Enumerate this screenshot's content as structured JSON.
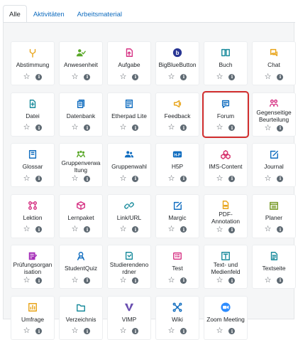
{
  "tabs": [
    {
      "label": "Alle",
      "active": true
    },
    {
      "label": "Aktivitäten",
      "active": false
    },
    {
      "label": "Arbeitsmaterial",
      "active": false
    }
  ],
  "tiles": [
    {
      "name": "Abstimmung",
      "icon": "choice-icon",
      "color": "#e8a419"
    },
    {
      "name": "Anwesenheit",
      "icon": "attendance-icon",
      "color": "#5aa829"
    },
    {
      "name": "Aufgabe",
      "icon": "assignment-icon",
      "color": "#d63384"
    },
    {
      "name": "BigBlueButton",
      "icon": "bigbluebutton-icon",
      "color": "#283593"
    },
    {
      "name": "Buch",
      "icon": "book-icon",
      "color": "#198b9c"
    },
    {
      "name": "Chat",
      "icon": "chat-icon",
      "color": "#e8a419"
    },
    {
      "name": "Datei",
      "icon": "file-icon",
      "color": "#198b9c"
    },
    {
      "name": "Datenbank",
      "icon": "database-icon",
      "color": "#0f6cbf"
    },
    {
      "name": "Etherpad Lite",
      "icon": "etherpad-icon",
      "color": "#0f6cbf"
    },
    {
      "name": "Feedback",
      "icon": "feedback-icon",
      "color": "#e8a419"
    },
    {
      "name": "Forum",
      "icon": "forum-icon",
      "color": "#0f6cbf",
      "selected": true
    },
    {
      "name": "Gegenseitige Beurteilung",
      "icon": "workshop-icon",
      "color": "#d63384"
    },
    {
      "name": "Glossar",
      "icon": "glossary-icon",
      "color": "#0f6cbf"
    },
    {
      "name": "Gruppenverwaltung",
      "icon": "groupmanagement-icon",
      "color": "#5aa829"
    },
    {
      "name": "Gruppenwahl",
      "icon": "groupchoice-icon",
      "color": "#0f6cbf"
    },
    {
      "name": "H5P",
      "icon": "h5p-icon",
      "color": "#0f6cbf"
    },
    {
      "name": "IMS-Content",
      "icon": "ims-content-icon",
      "color": "#d6336c"
    },
    {
      "name": "Journal",
      "icon": "journal-icon",
      "color": "#0f6cbf"
    },
    {
      "name": "Lektion",
      "icon": "lesson-icon",
      "color": "#d63384"
    },
    {
      "name": "Lernpaket",
      "icon": "scorm-icon",
      "color": "#d63384"
    },
    {
      "name": "Link/URL",
      "icon": "link-icon",
      "color": "#198b9c"
    },
    {
      "name": "Margic",
      "icon": "margic-icon",
      "color": "#0f6cbf"
    },
    {
      "name": "PDF-Annotation",
      "icon": "pdf-annotation-icon",
      "color": "#e8a419"
    },
    {
      "name": "Planer",
      "icon": "planner-icon",
      "color": "#7a9b2a"
    },
    {
      "name": "Prüfungsorganisation",
      "icon": "exam-organisation-icon",
      "color": "#a62fb9"
    },
    {
      "name": "StudentQuiz",
      "icon": "studentquiz-icon",
      "color": "#0f6cbf"
    },
    {
      "name": "Studierendenordner",
      "icon": "student-folder-icon",
      "color": "#198b9c"
    },
    {
      "name": "Test",
      "icon": "quiz-icon",
      "color": "#d63384"
    },
    {
      "name": "Text- und Medienfeld",
      "icon": "label-icon",
      "color": "#198b9c"
    },
    {
      "name": "Textseite",
      "icon": "page-icon",
      "color": "#198b9c"
    },
    {
      "name": "Umfrage",
      "icon": "survey-icon",
      "color": "#e8a419"
    },
    {
      "name": "Verzeichnis",
      "icon": "folder-icon",
      "color": "#198b9c"
    },
    {
      "name": "VIMP",
      "icon": "vimp-icon",
      "color": "#4a3b8f"
    },
    {
      "name": "Wiki",
      "icon": "wiki-icon",
      "color": "#0f6cbf"
    },
    {
      "name": "Zoom Meeting",
      "icon": "zoom-icon",
      "color": "#2d8cff"
    }
  ]
}
